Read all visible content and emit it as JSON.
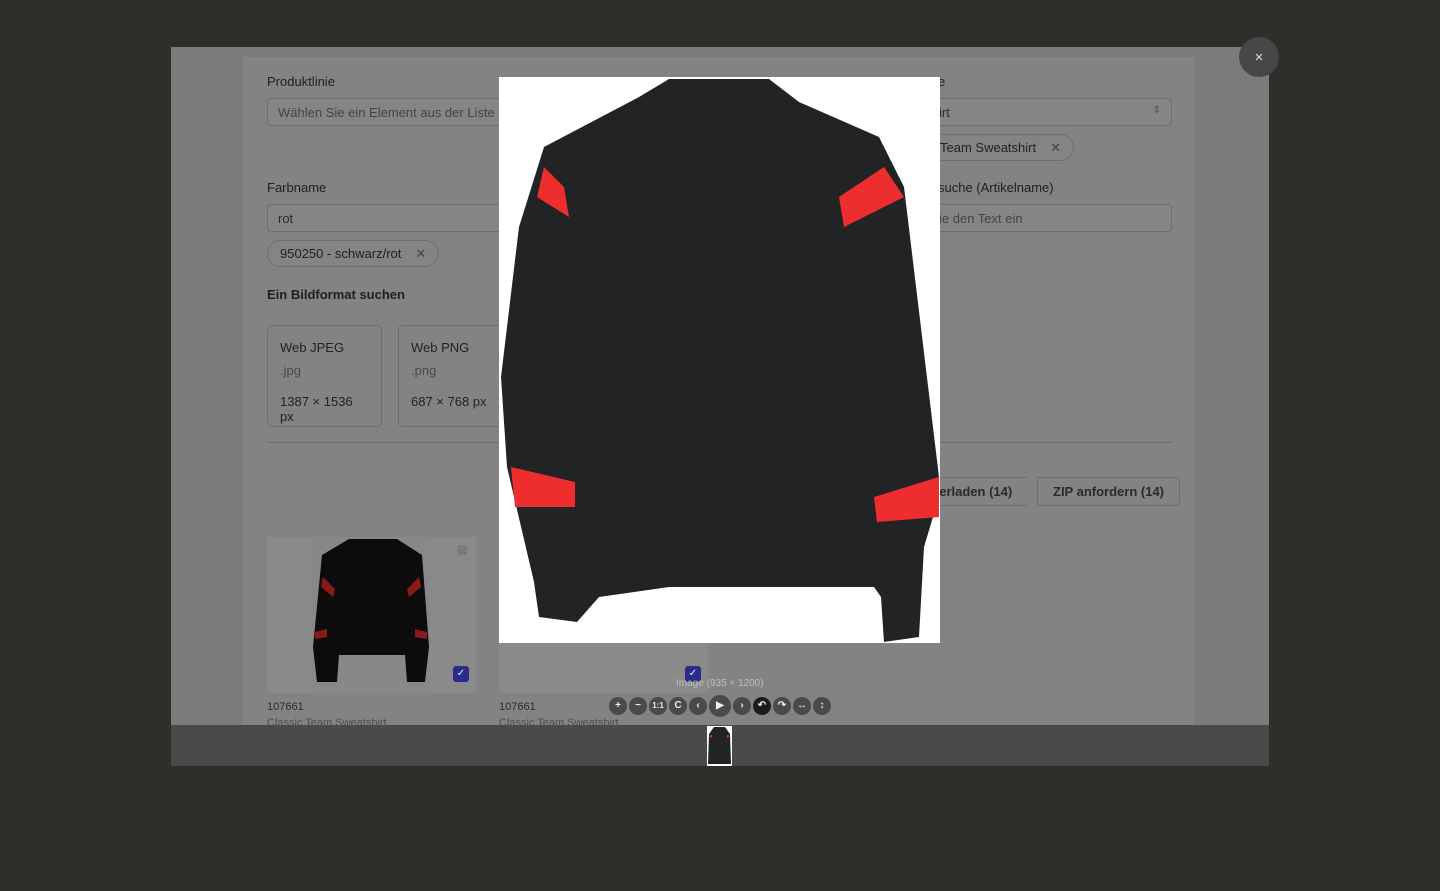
{
  "form": {
    "product_line": {
      "label": "Produktlinie",
      "placeholder": "Wählen Sie ein Element aus der Liste"
    },
    "product_name": {
      "label_partial": "e",
      "value_partial": "irt",
      "chip_partial": "Team Sweatshirt"
    },
    "color": {
      "label": "Farbname",
      "value": "rot",
      "chip": "950250 - schwarz/rot"
    },
    "search": {
      "label_partial": "suche (Artikelname)",
      "placeholder_partial": "ie den Text ein"
    },
    "format_title": "Ein Bildformat suchen",
    "formats": [
      {
        "name": "Web JPEG",
        "ext": ".jpg",
        "dims": "1387 × 1536 px"
      },
      {
        "name": "Web PNG",
        "ext": ".png",
        "dims": "687 × 768 px"
      }
    ],
    "buttons": {
      "download_partial": "unterladen (14)",
      "zip": "ZIP anfordern (14)"
    }
  },
  "results": [
    {
      "id": "107661",
      "name": "Classic Team Sweatshirt"
    },
    {
      "id": "107661",
      "name": "Classic Team Sweatshirt"
    }
  ],
  "viewer": {
    "caption": "Image (935 × 1200)",
    "close": "×",
    "toolbar": [
      {
        "icon": "zoom-in-icon",
        "glyph": "+"
      },
      {
        "icon": "zoom-out-icon",
        "glyph": "−"
      },
      {
        "icon": "one-to-one-icon",
        "glyph": "1:1"
      },
      {
        "icon": "reset-icon",
        "glyph": "C"
      },
      {
        "icon": "prev-icon",
        "glyph": "‹"
      },
      {
        "icon": "play-icon",
        "glyph": "▶"
      },
      {
        "icon": "next-icon",
        "glyph": "›"
      },
      {
        "icon": "rotate-left-icon",
        "glyph": "↶"
      },
      {
        "icon": "rotate-right-icon",
        "glyph": "↷"
      },
      {
        "icon": "flip-horizontal-icon",
        "glyph": "↔"
      },
      {
        "icon": "flip-vertical-icon",
        "glyph": "↕"
      }
    ],
    "colors": {
      "shirt": "#222325",
      "stripe": "#ee2e2e"
    }
  }
}
